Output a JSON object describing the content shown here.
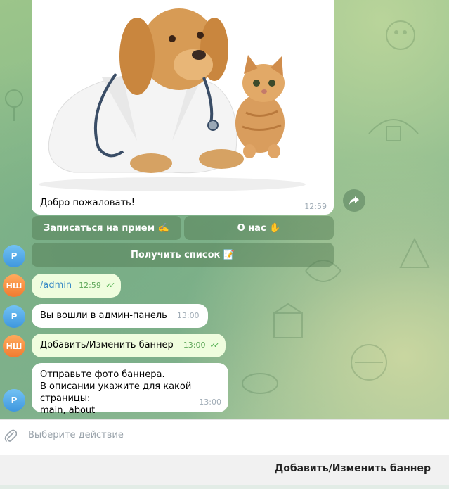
{
  "photo_message": {
    "caption": "Добро пожаловать!",
    "time": "12:59"
  },
  "inline_keyboard": {
    "book_label": "Записаться на прием ✍️",
    "about_label": "О нас ✋",
    "list_label": "Получить список 📝"
  },
  "avatars": {
    "bot_initials": "Р",
    "user_initials": "НШ"
  },
  "messages": [
    {
      "text": "/admin",
      "time": "12:59"
    },
    {
      "text": "Вы вошли в админ-панель",
      "time": "13:00"
    },
    {
      "text": "Добавить/Изменить баннер",
      "time": "13:00"
    },
    {
      "line1": "Отправьте фото баннера.",
      "line2": "В описании укажите для какой страницы:",
      "line3": "main, about",
      "time": "13:00"
    }
  ],
  "input": {
    "placeholder": "Выберите действие"
  },
  "reply_keyboard": {
    "button_label": "Добавить/Изменить баннер"
  },
  "icons": {
    "share": "share-icon",
    "attach": "paperclip-icon",
    "read": "double-check-icon"
  }
}
